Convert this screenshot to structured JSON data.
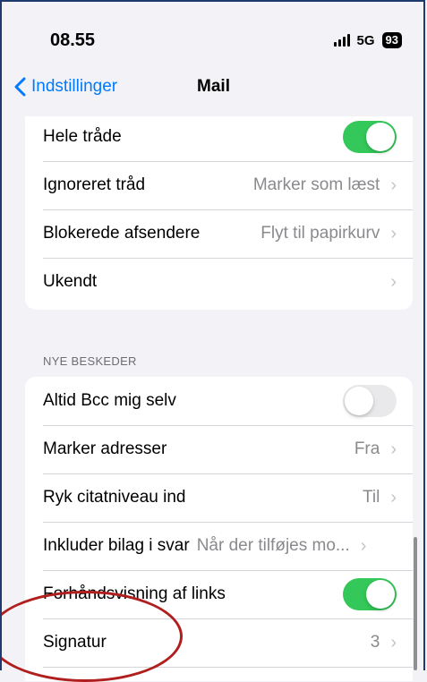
{
  "status": {
    "time": "08.55",
    "network": "5G",
    "battery": "93"
  },
  "nav": {
    "back_label": "Indstillinger",
    "title": "Mail"
  },
  "threading": {
    "rows": [
      {
        "label": "Hele tråde",
        "toggle": "on"
      },
      {
        "label": "Ignoreret tråd",
        "value": "Marker som læst"
      },
      {
        "label": "Blokerede afsendere",
        "value": "Flyt til papirkurv"
      },
      {
        "label": "Ukendt",
        "value": ""
      }
    ]
  },
  "compose": {
    "header": "NYE BESKEDER",
    "rows": [
      {
        "label": "Altid Bcc mig selv",
        "toggle": "off"
      },
      {
        "label": "Marker adresser",
        "value": "Fra"
      },
      {
        "label": "Ryk citatniveau ind",
        "value": "Til"
      },
      {
        "label": "Inkluder bilag i svar",
        "value": "Når der tilføjes mo..."
      },
      {
        "label": "Forhåndsvisning af links",
        "toggle": "on"
      },
      {
        "label": "Signatur",
        "value": "3"
      }
    ]
  },
  "colors": {
    "accent": "#007aff",
    "toggle_on": "#34c759",
    "annotation": "#b01e1e"
  }
}
